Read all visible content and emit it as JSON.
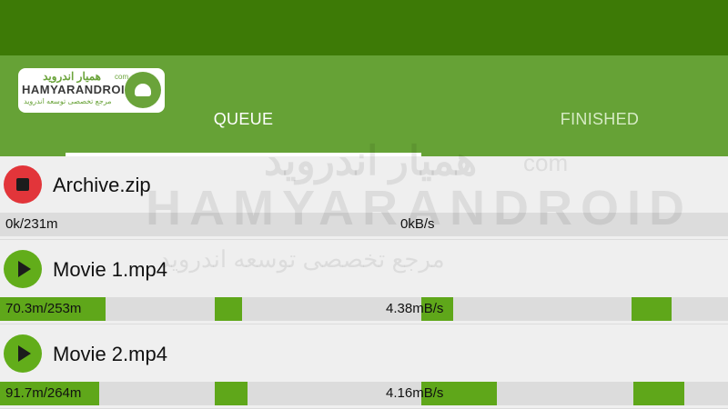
{
  "logo": {
    "text_fa": "همیار اندروید",
    "text_en": "HAMYARANDROID",
    "com": "com",
    "subtitle_fa": "مرجع تخصصی توسعه اندروید"
  },
  "tabs": [
    {
      "label": "QUEUE",
      "active": true
    },
    {
      "label": "FINISHED",
      "active": false
    }
  ],
  "downloads": [
    {
      "name": "Archive.zip",
      "state_icon": "stop-icon",
      "progress_text": "0k/231m",
      "speed_text": "0kB/s",
      "fraction": 0.0
    },
    {
      "name": "Movie 1.mp4",
      "state_icon": "play-icon",
      "progress_text": "70.3m/253m",
      "speed_text": "4.38mB/s",
      "fraction": 0.278
    },
    {
      "name": "Movie 2.mp4",
      "state_icon": "play-icon",
      "progress_text": "91.7m/264m",
      "speed_text": "4.16mB/s",
      "fraction": 0.347
    }
  ],
  "colors": {
    "status_bar": "#3d7a06",
    "app_bar": "#66a236",
    "progress": "#5fa71a",
    "stop": "#e2353a",
    "play": "#62ad1a"
  }
}
